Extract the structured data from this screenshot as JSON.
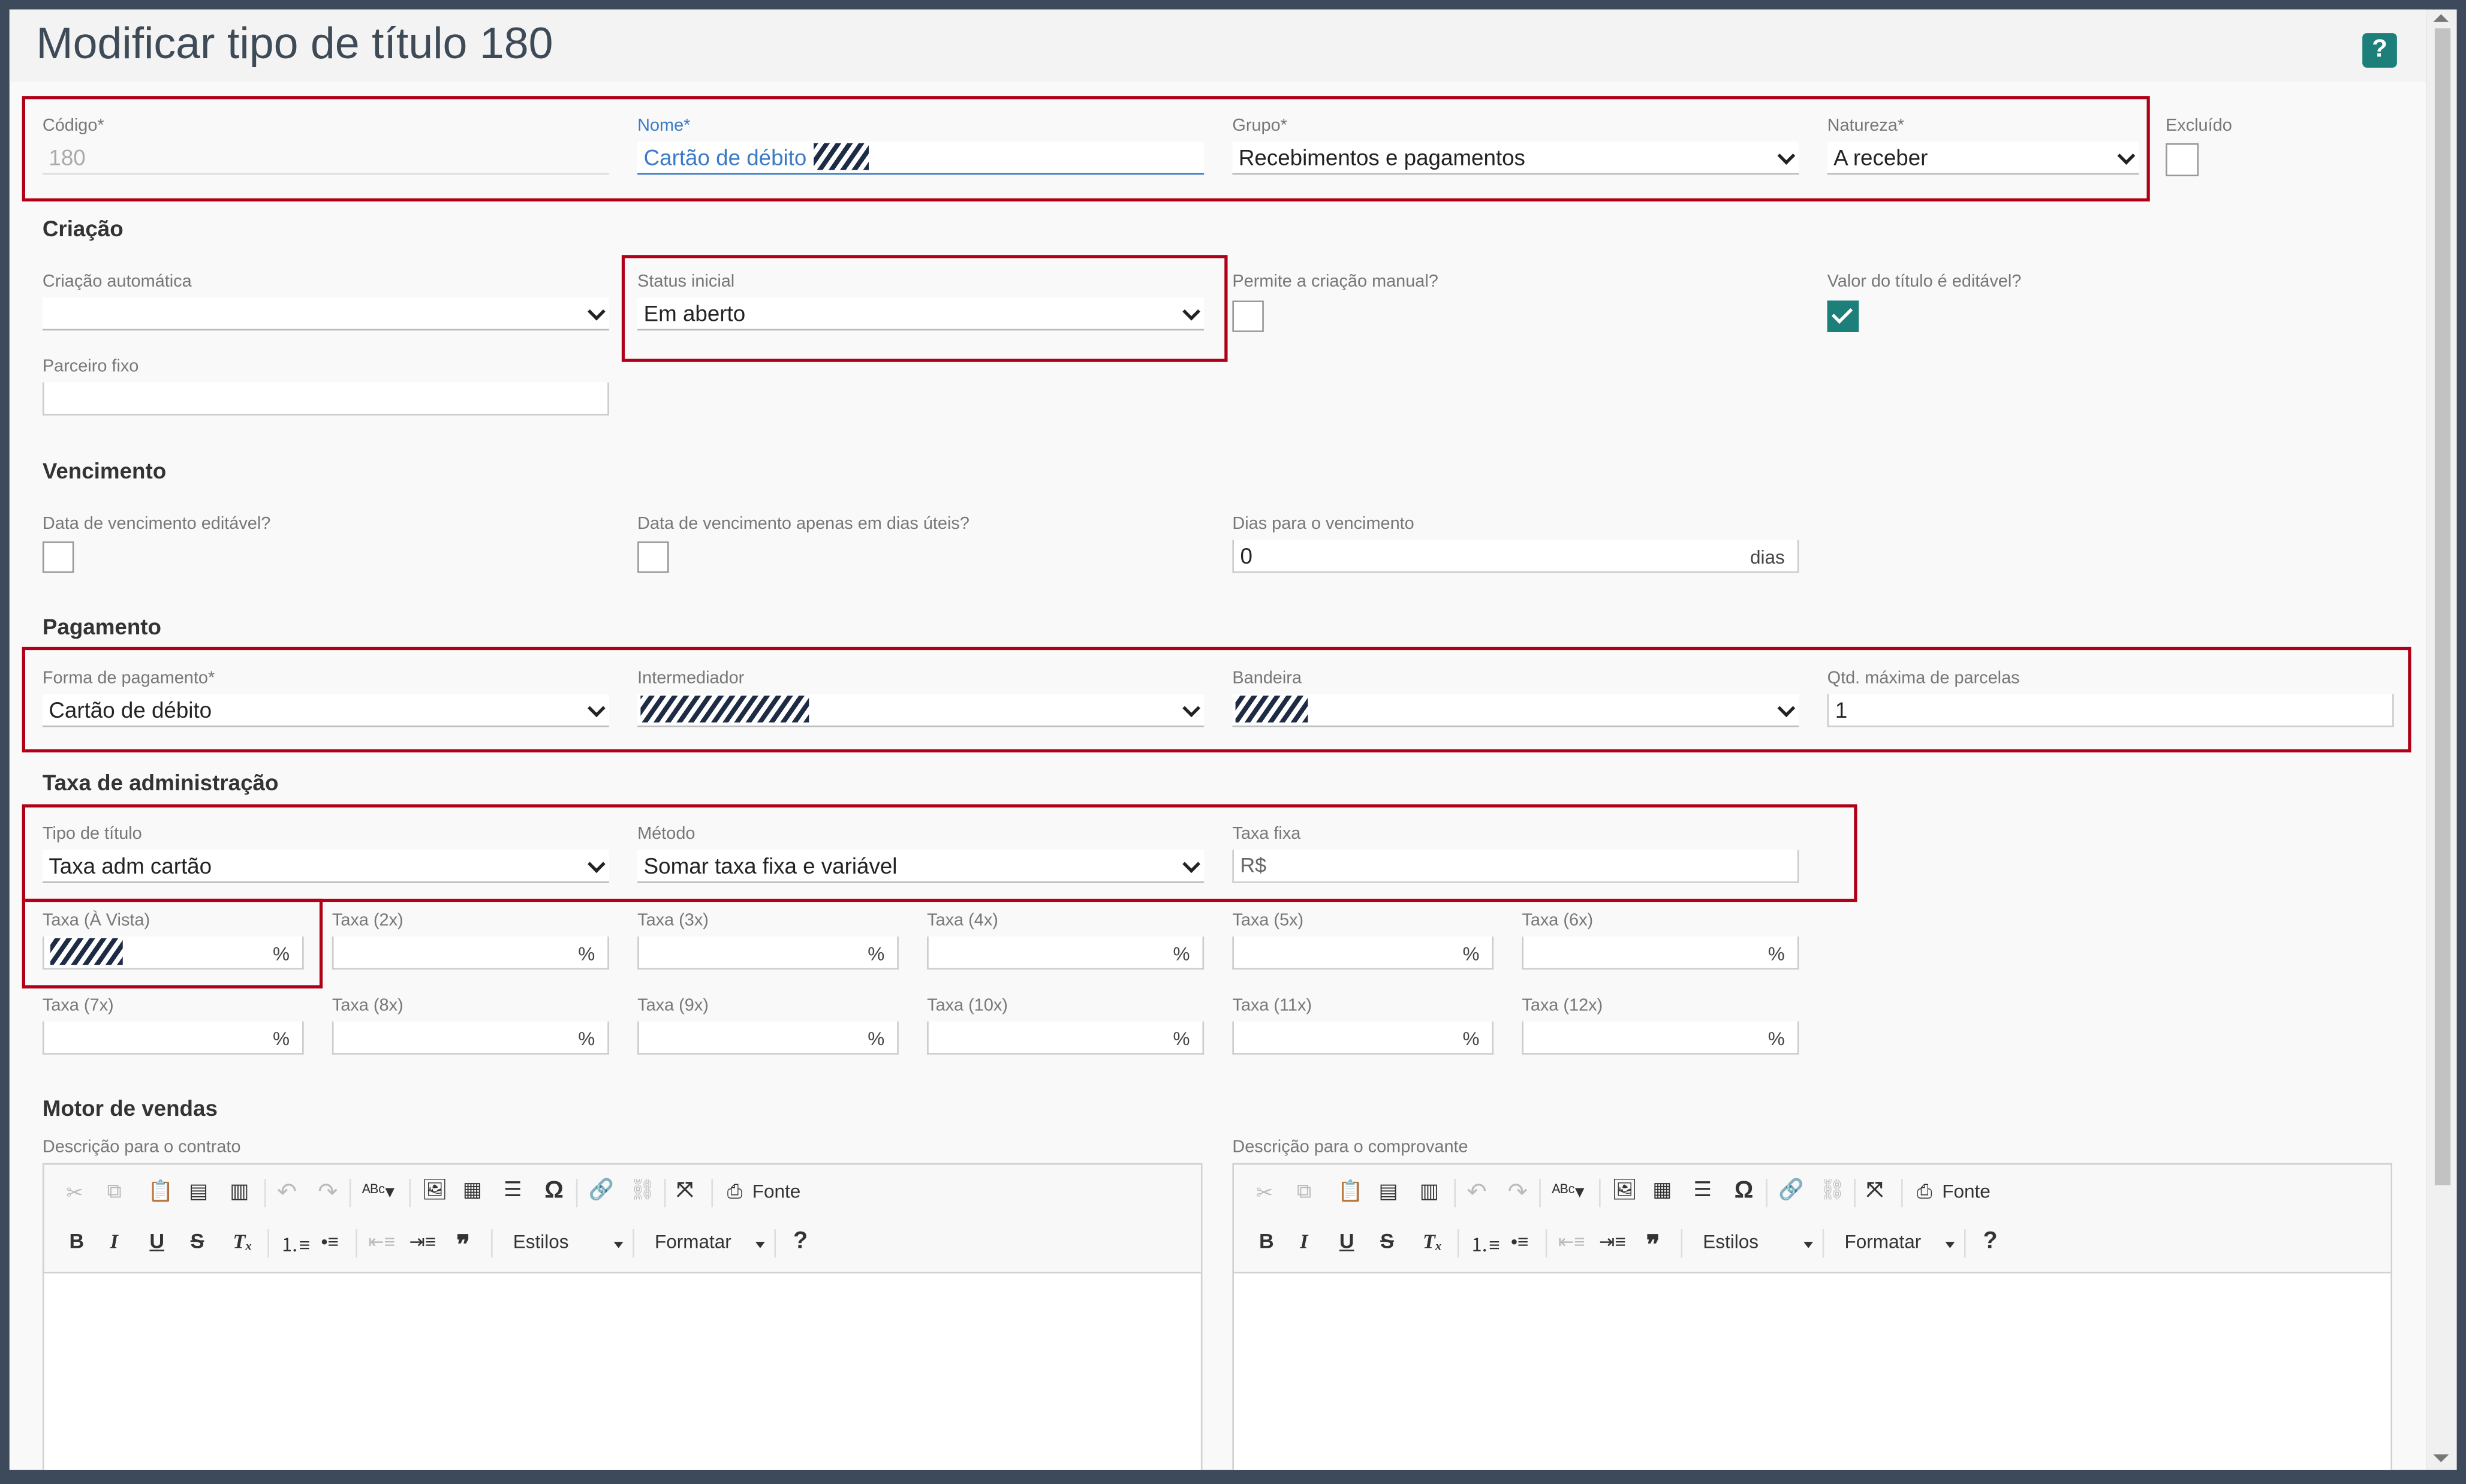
{
  "page": {
    "title": "Modificar tipo de título 180",
    "help_label": "?"
  },
  "header_fields": {
    "codigo": {
      "label": "Código*",
      "value": "180"
    },
    "nome": {
      "label": "Nome*",
      "value": "Cartão de débito"
    },
    "grupo": {
      "label": "Grupo*",
      "value": "Recebimentos e pagamentos"
    },
    "natureza": {
      "label": "Natureza*",
      "value": "A receber"
    },
    "excluido": {
      "label": "Excluído",
      "checked": false
    }
  },
  "criacao": {
    "title": "Criação",
    "criacao_automatica": {
      "label": "Criação automática",
      "value": ""
    },
    "status_inicial": {
      "label": "Status inicial",
      "value": "Em aberto"
    },
    "permite_manual": {
      "label": "Permite a criação manual?",
      "checked": false
    },
    "valor_editavel": {
      "label": "Valor do título é editável?",
      "checked": true
    },
    "parceiro_fixo": {
      "label": "Parceiro fixo",
      "value": ""
    }
  },
  "vencimento": {
    "title": "Vencimento",
    "data_editavel": {
      "label": "Data de vencimento editável?",
      "checked": false
    },
    "dias_uteis": {
      "label": "Data de vencimento apenas em dias úteis?",
      "checked": false
    },
    "dias": {
      "label": "Dias para o vencimento",
      "value": "0",
      "suffix": "dias"
    }
  },
  "pagamento": {
    "title": "Pagamento",
    "forma": {
      "label": "Forma de pagamento*",
      "value": "Cartão de débito"
    },
    "intermediador": {
      "label": "Intermediador",
      "value": ""
    },
    "bandeira": {
      "label": "Bandeira",
      "value": ""
    },
    "parcelas": {
      "label": "Qtd. máxima de parcelas",
      "value": "1"
    }
  },
  "taxa": {
    "title": "Taxa de administração",
    "tipo_titulo": {
      "label": "Tipo de título",
      "value": "Taxa adm cartão"
    },
    "metodo": {
      "label": "Método",
      "value": "Somar taxa fixa e variável"
    },
    "taxa_fixa": {
      "label": "Taxa fixa",
      "placeholder": "R$"
    },
    "percent": "%",
    "rates": [
      {
        "label": "Taxa (À Vista)",
        "value": ""
      },
      {
        "label": "Taxa (2x)",
        "value": ""
      },
      {
        "label": "Taxa (3x)",
        "value": ""
      },
      {
        "label": "Taxa (4x)",
        "value": ""
      },
      {
        "label": "Taxa (5x)",
        "value": ""
      },
      {
        "label": "Taxa (6x)",
        "value": ""
      },
      {
        "label": "Taxa (7x)",
        "value": ""
      },
      {
        "label": "Taxa (8x)",
        "value": ""
      },
      {
        "label": "Taxa (9x)",
        "value": ""
      },
      {
        "label": "Taxa (10x)",
        "value": ""
      },
      {
        "label": "Taxa (11x)",
        "value": ""
      },
      {
        "label": "Taxa (12x)",
        "value": ""
      }
    ]
  },
  "motor": {
    "title": "Motor de vendas",
    "contrato_label": "Descrição para o contrato",
    "comprovante_label": "Descrição para o comprovante",
    "toolbar": {
      "fonte": "Fonte",
      "estilos": "Estilos",
      "formatar": "Formatar",
      "help": "?"
    }
  },
  "colors": {
    "accent": "#1d7f7a",
    "highlight": "#b00018",
    "link": "#3b7ac6"
  },
  "icons": [
    "cut-icon",
    "copy-icon",
    "paste-icon",
    "paste-text-icon",
    "paste-word-icon",
    "undo-icon",
    "redo-icon",
    "spellcheck-icon",
    "image-icon",
    "table-icon",
    "horizontal-rule-icon",
    "special-char-icon",
    "link-icon",
    "unlink-icon",
    "maximize-icon",
    "source-icon",
    "bold-icon",
    "italic-icon",
    "underline-icon",
    "strike-icon",
    "remove-format-icon",
    "numbered-list-icon",
    "bullet-list-icon",
    "outdent-icon",
    "indent-icon",
    "blockquote-icon"
  ]
}
